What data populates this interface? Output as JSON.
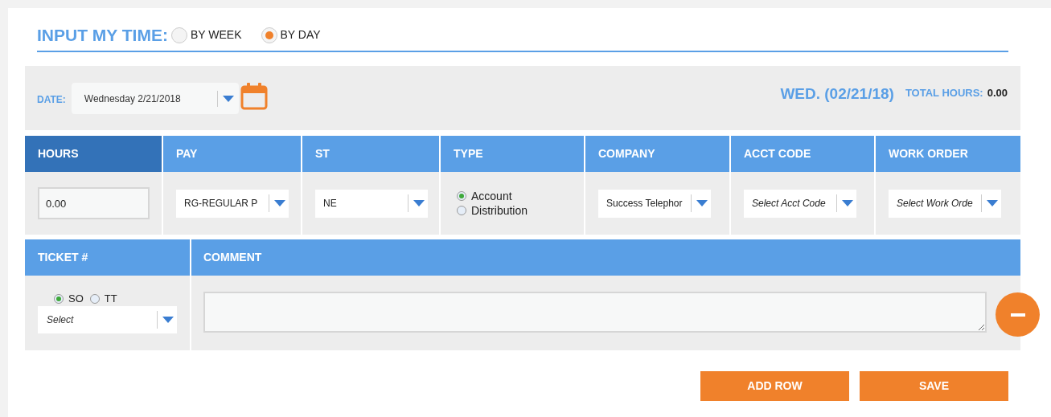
{
  "title": "INPUT MY TIME:",
  "view_modes": [
    {
      "label": "BY WEEK",
      "selected": false
    },
    {
      "label": "BY DAY",
      "selected": true
    }
  ],
  "date_bar": {
    "label": "DATE:",
    "date_value": "Wednesday 2/21/2018",
    "day_heading": "WED. (02/21/18)",
    "total_label": "TOTAL HOURS:",
    "total_value": "0.00"
  },
  "columns": [
    {
      "label": "HOURS",
      "selected": true,
      "kind": "input",
      "value": "0.00"
    },
    {
      "label": "PAY",
      "selected": false,
      "kind": "select",
      "value": "RG-REGULAR P"
    },
    {
      "label": "ST",
      "selected": false,
      "kind": "select",
      "value": "NE"
    },
    {
      "label": "TYPE",
      "selected": false,
      "kind": "radios",
      "options": [
        {
          "label": "Account",
          "selected": true
        },
        {
          "label": "Distribution",
          "selected": false
        }
      ]
    },
    {
      "label": "COMPANY",
      "selected": false,
      "kind": "select",
      "value": "Success Telephor"
    },
    {
      "label": "ACCT CODE",
      "selected": false,
      "kind": "select",
      "placeholder": "Select Acct Code"
    },
    {
      "label": "WORK ORDER",
      "selected": false,
      "kind": "select",
      "placeholder": "Select Work Orde"
    }
  ],
  "ticket": {
    "label": "TICKET #",
    "options": [
      {
        "label": "SO",
        "selected": true
      },
      {
        "label": "TT",
        "selected": false
      }
    ],
    "placeholder": "Select"
  },
  "comment": {
    "label": "COMMENT"
  },
  "buttons": [
    "ADD ROW",
    "SAVE"
  ]
}
